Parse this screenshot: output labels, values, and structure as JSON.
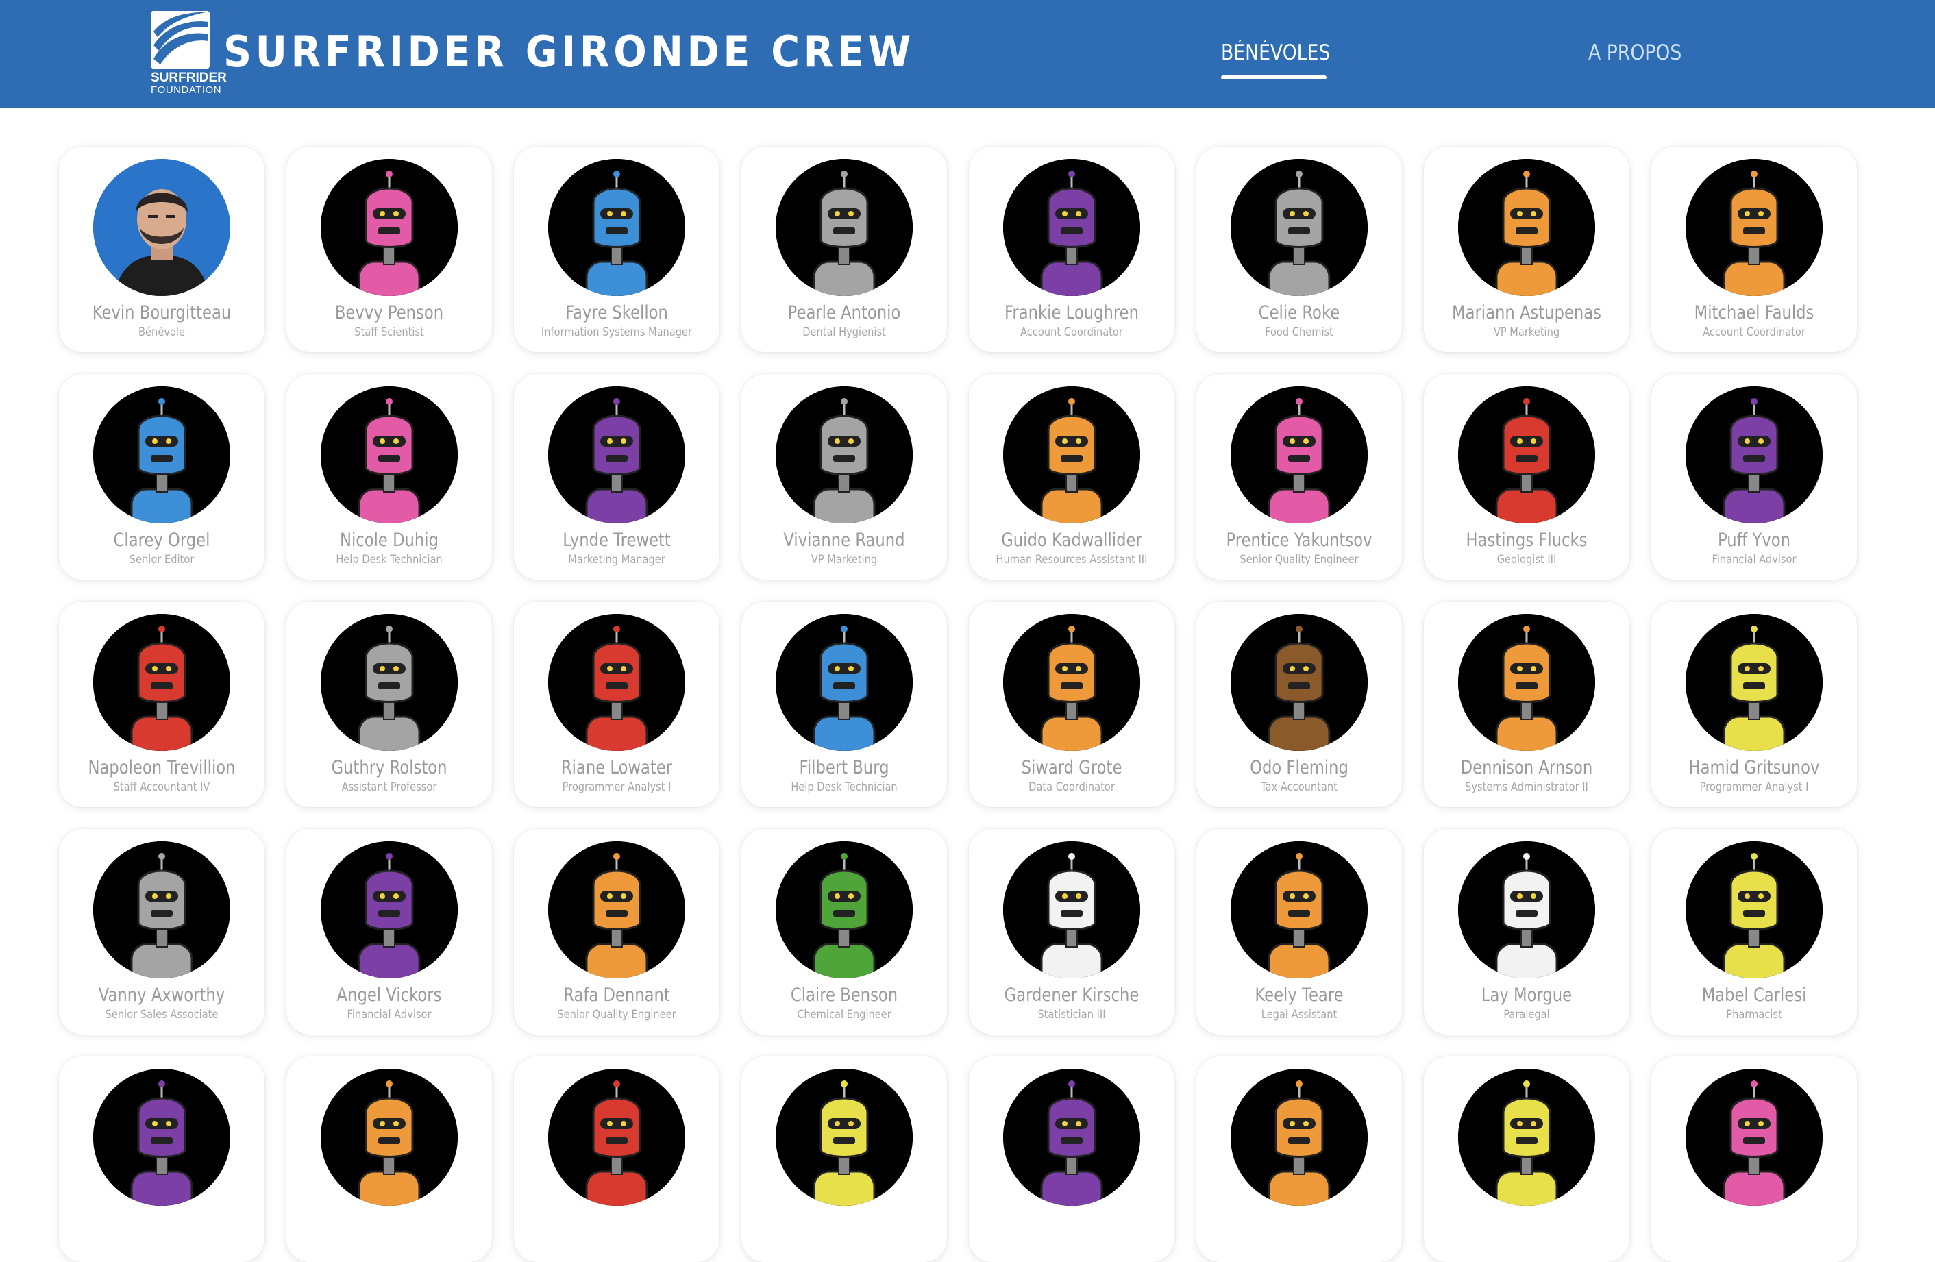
{
  "header": {
    "logo_line1": "SURFRIDER",
    "logo_line2": "FOUNDATION",
    "title": "SURFRIDER GIRONDE CREW",
    "nav": [
      {
        "label": "BÉNÉVOLES",
        "active": true
      },
      {
        "label": "A PROPOS",
        "active": false
      }
    ],
    "bar_color": "#2e6db4"
  },
  "members": [
    {
      "name": "Kevin Bourgitteau",
      "role": "Bénévole",
      "avatar": "photo",
      "color": "#2a75c9"
    },
    {
      "name": "Bevvy Penson",
      "role": "Staff Scientist",
      "avatar": "robot",
      "color": "#e35aa6"
    },
    {
      "name": "Fayre Skellon",
      "role": "Information Systems Manager",
      "avatar": "robot",
      "color": "#3d8fd8"
    },
    {
      "name": "Pearle Antonio",
      "role": "Dental Hygienist",
      "avatar": "robot",
      "color": "#a4a4a4"
    },
    {
      "name": "Frankie Loughren",
      "role": "Account Coordinator",
      "avatar": "robot",
      "color": "#7b3fa6"
    },
    {
      "name": "Celie Roke",
      "role": "Food Chemist",
      "avatar": "robot",
      "color": "#a4a4a4"
    },
    {
      "name": "Mariann Astupenas",
      "role": "VP Marketing",
      "avatar": "robot",
      "color": "#ee9a3a"
    },
    {
      "name": "Mitchael Faulds",
      "role": "Account Coordinator",
      "avatar": "robot",
      "color": "#ee9a3a"
    },
    {
      "name": "Clarey Orgel",
      "role": "Senior Editor",
      "avatar": "robot",
      "color": "#3d8fd8"
    },
    {
      "name": "Nicole Duhig",
      "role": "Help Desk Technician",
      "avatar": "robot",
      "color": "#e35aa6"
    },
    {
      "name": "Lynde Trewett",
      "role": "Marketing Manager",
      "avatar": "robot",
      "color": "#7b3fa6"
    },
    {
      "name": "Vivianne Raund",
      "role": "VP Marketing",
      "avatar": "robot",
      "color": "#a4a4a4"
    },
    {
      "name": "Guido Kadwallider",
      "role": "Human Resources Assistant III",
      "avatar": "robot",
      "color": "#ee9a3a"
    },
    {
      "name": "Prentice Yakuntsov",
      "role": "Senior Quality Engineer",
      "avatar": "robot",
      "color": "#e35aa6"
    },
    {
      "name": "Hastings Flucks",
      "role": "Geologist III",
      "avatar": "robot",
      "color": "#d93a2f"
    },
    {
      "name": "Puff Yvon",
      "role": "Financial Advisor",
      "avatar": "robot",
      "color": "#7b3fa6"
    },
    {
      "name": "Napoleon Trevillion",
      "role": "Staff Accountant IV",
      "avatar": "robot",
      "color": "#d93a2f"
    },
    {
      "name": "Guthry Rolston",
      "role": "Assistant Professor",
      "avatar": "robot",
      "color": "#a4a4a4"
    },
    {
      "name": "Riane Lowater",
      "role": "Programmer Analyst I",
      "avatar": "robot",
      "color": "#d93a2f"
    },
    {
      "name": "Filbert Burg",
      "role": "Help Desk Technician",
      "avatar": "robot",
      "color": "#3d8fd8"
    },
    {
      "name": "Siward Grote",
      "role": "Data Coordinator",
      "avatar": "robot",
      "color": "#ee9a3a"
    },
    {
      "name": "Odo Fleming",
      "role": "Tax Accountant",
      "avatar": "robot",
      "color": "#8b5a2b"
    },
    {
      "name": "Dennison Arnson",
      "role": "Systems Administrator II",
      "avatar": "robot",
      "color": "#ee9a3a"
    },
    {
      "name": "Hamid Gritsunov",
      "role": "Programmer Analyst I",
      "avatar": "robot",
      "color": "#e8e04a"
    },
    {
      "name": "Vanny Axworthy",
      "role": "Senior Sales Associate",
      "avatar": "robot",
      "color": "#a4a4a4"
    },
    {
      "name": "Angel Vickors",
      "role": "Financial Advisor",
      "avatar": "robot",
      "color": "#7b3fa6"
    },
    {
      "name": "Rafa Dennant",
      "role": "Senior Quality Engineer",
      "avatar": "robot",
      "color": "#ee9a3a"
    },
    {
      "name": "Claire Benson",
      "role": "Chemical Engineer",
      "avatar": "robot",
      "color": "#4fa53a"
    },
    {
      "name": "Gardener Kirsche",
      "role": "Statistician III",
      "avatar": "robot",
      "color": "#f2f2f2"
    },
    {
      "name": "Keely Teare",
      "role": "Legal Assistant",
      "avatar": "robot",
      "color": "#ee9a3a"
    },
    {
      "name": "Lay Morgue",
      "role": "Paralegal",
      "avatar": "robot",
      "color": "#f2f2f2"
    },
    {
      "name": "Mabel Carlesi",
      "role": "Pharmacist",
      "avatar": "robot",
      "color": "#e8e04a"
    },
    {
      "name": "",
      "role": "",
      "avatar": "robot",
      "color": "#7b3fa6"
    },
    {
      "name": "",
      "role": "",
      "avatar": "robot",
      "color": "#ee9a3a"
    },
    {
      "name": "",
      "role": "",
      "avatar": "robot",
      "color": "#d93a2f"
    },
    {
      "name": "",
      "role": "",
      "avatar": "robot",
      "color": "#e8e04a"
    },
    {
      "name": "",
      "role": "",
      "avatar": "robot",
      "color": "#7b3fa6"
    },
    {
      "name": "",
      "role": "",
      "avatar": "robot",
      "color": "#ee9a3a"
    },
    {
      "name": "",
      "role": "",
      "avatar": "robot",
      "color": "#e8e04a"
    },
    {
      "name": "",
      "role": "",
      "avatar": "robot",
      "color": "#e35aa6"
    }
  ]
}
